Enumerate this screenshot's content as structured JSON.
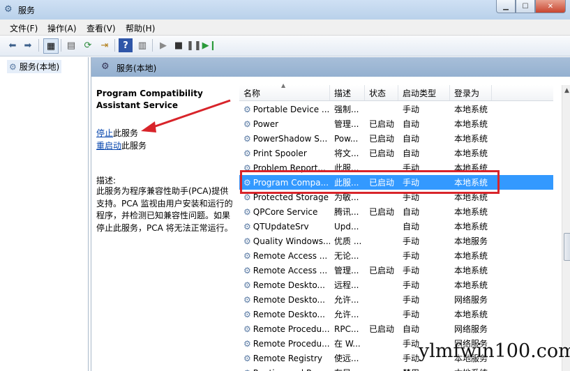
{
  "window": {
    "title": "服务"
  },
  "menu": [
    "文件(F)",
    "操作(A)",
    "查看(V)",
    "帮助(H)"
  ],
  "toolbar": {
    "icons": [
      "back-icon",
      "forward-icon",
      "show-hide-tree-icon",
      "properties-icon",
      "refresh-icon",
      "export-icon",
      "help-icon",
      "view-icon",
      "start-icon",
      "stop-icon",
      "pause-icon",
      "restart-icon"
    ]
  },
  "tree": {
    "root_label": "服务(本地)"
  },
  "panel": {
    "header": "服务(本地)",
    "service_title": "Program Compatibility Assistant Service",
    "stop_link": "停止",
    "stop_suffix": "此服务",
    "restart_link": "重启动",
    "restart_suffix": "此服务",
    "desc_label": "描述:",
    "description": "此服务为程序兼容性助手(PCA)提供支持。PCA 监视由用户安装和运行的程序，并检测已知兼容性问题。如果停止此服务，PCA 将无法正常运行。"
  },
  "columns": [
    "名称",
    "描述",
    "状态",
    "启动类型",
    "登录为"
  ],
  "rows": [
    {
      "name": "Portable Device ...",
      "desc": "强制...",
      "status": "",
      "start": "手动",
      "logon": "本地系统"
    },
    {
      "name": "Power",
      "desc": "管理...",
      "status": "已启动",
      "start": "自动",
      "logon": "本地系统"
    },
    {
      "name": "PowerShadow S...",
      "desc": "Pow...",
      "status": "已启动",
      "start": "自动",
      "logon": "本地系统"
    },
    {
      "name": "Print Spooler",
      "desc": "将文...",
      "status": "已启动",
      "start": "自动",
      "logon": "本地系统"
    },
    {
      "name": "Problem Report...",
      "desc": "此服...",
      "status": "",
      "start": "手动",
      "logon": "本地系统"
    },
    {
      "name": "Program Compa...",
      "desc": "此服...",
      "status": "已启动",
      "start": "手动",
      "logon": "本地系统",
      "selected": true
    },
    {
      "name": "Protected Storage",
      "desc": "为敏...",
      "status": "",
      "start": "手动",
      "logon": "本地系统"
    },
    {
      "name": "QPCore Service",
      "desc": "腾讯...",
      "status": "已启动",
      "start": "自动",
      "logon": "本地系统"
    },
    {
      "name": "QTUpdateSrv",
      "desc": "Upd...",
      "status": "",
      "start": "自动",
      "logon": "本地系统"
    },
    {
      "name": "Quality Windows...",
      "desc": "优质 ...",
      "status": "",
      "start": "手动",
      "logon": "本地服务"
    },
    {
      "name": "Remote Access ...",
      "desc": "无论...",
      "status": "",
      "start": "手动",
      "logon": "本地系统"
    },
    {
      "name": "Remote Access ...",
      "desc": "管理...",
      "status": "已启动",
      "start": "手动",
      "logon": "本地系统"
    },
    {
      "name": "Remote Deskto...",
      "desc": "远程...",
      "status": "",
      "start": "手动",
      "logon": "本地系统"
    },
    {
      "name": "Remote Deskto...",
      "desc": "允许...",
      "status": "",
      "start": "手动",
      "logon": "网络服务"
    },
    {
      "name": "Remote Deskto...",
      "desc": "允许...",
      "status": "",
      "start": "手动",
      "logon": "本地系统"
    },
    {
      "name": "Remote Procedu...",
      "desc": "RPC...",
      "status": "已启动",
      "start": "自动",
      "logon": "网络服务"
    },
    {
      "name": "Remote Procedu...",
      "desc": "在 W...",
      "status": "",
      "start": "手动",
      "logon": "网络服务"
    },
    {
      "name": "Remote Registry",
      "desc": "使远...",
      "status": "",
      "start": "手动",
      "logon": "本地服务"
    },
    {
      "name": "Routing and Re...",
      "desc": "在局...",
      "status": "",
      "start": "禁用",
      "logon": "本地系统"
    }
  ],
  "annotation_color": "#d8242a",
  "watermark": "ylmfwin100.com"
}
